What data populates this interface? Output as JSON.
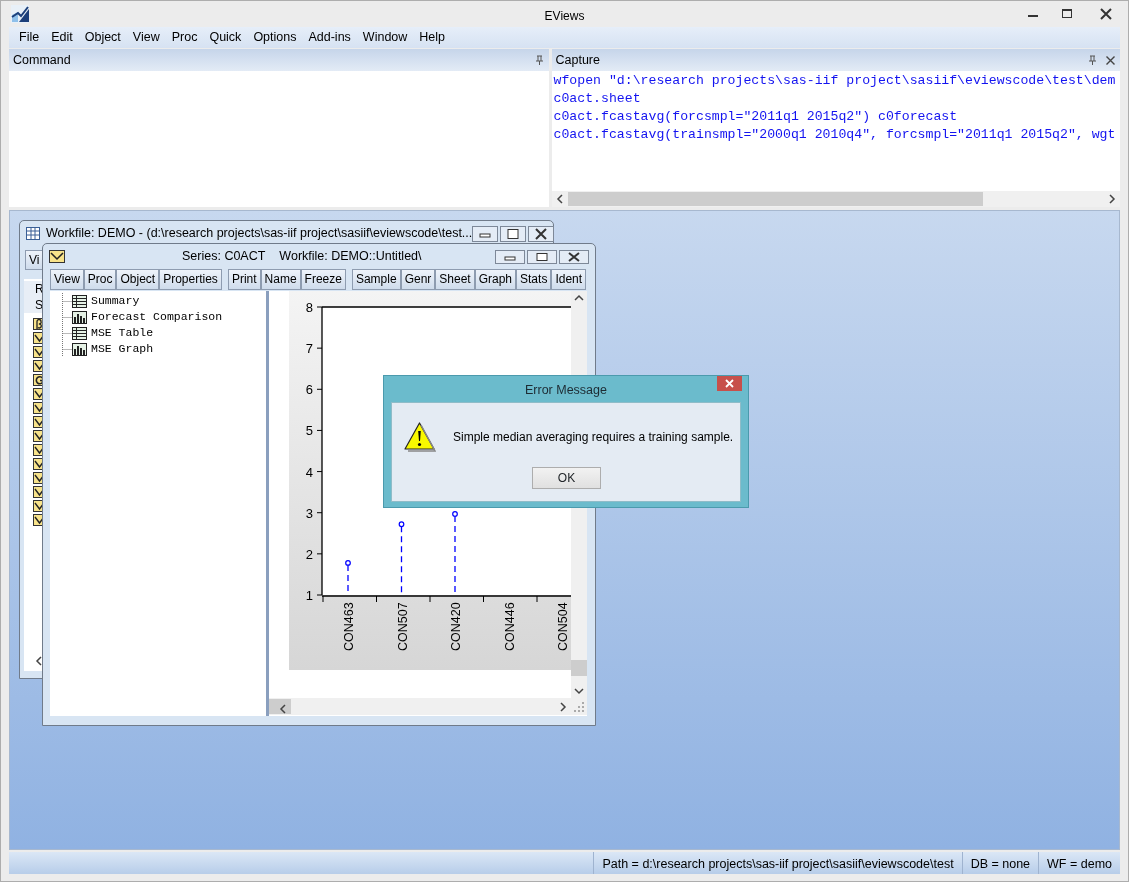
{
  "app": {
    "title": "EViews"
  },
  "menu": [
    {
      "label": "File"
    },
    {
      "label": "Edit"
    },
    {
      "label": "Object"
    },
    {
      "label": "View"
    },
    {
      "label": "Proc"
    },
    {
      "label": "Quick"
    },
    {
      "label": "Options"
    },
    {
      "label": "Add-ins"
    },
    {
      "label": "Window"
    },
    {
      "label": "Help"
    }
  ],
  "command_pane": {
    "title": "Command"
  },
  "capture_pane": {
    "title": "Capture",
    "lines": [
      "wfopen \"d:\\research projects\\sas-iif project\\sasiif\\eviewscode\\test\\dem",
      "c0act.sheet",
      "c0act.fcastavg(forcsmpl=\"2011q1 2015q2\") c0forecast",
      "c0act.fcastavg(trainsmpl=\"2000q1 2010q4\", forcsmpl=\"2011q1 2015q2\", wgt"
    ]
  },
  "workfile_window": {
    "title": "Workfile: DEMO - (d:\\research projects\\sas-iif project\\sasiif\\eviewscode\\test...",
    "toolbar": [
      "Vi"
    ],
    "labels": [
      "R",
      "S"
    ],
    "objects": [
      {
        "kind": "coef"
      },
      {
        "kind": "series"
      },
      {
        "kind": "series"
      },
      {
        "kind": "series"
      },
      {
        "kind": "group"
      },
      {
        "kind": "series"
      },
      {
        "kind": "series"
      },
      {
        "kind": "series"
      },
      {
        "kind": "series"
      },
      {
        "kind": "series"
      },
      {
        "kind": "series"
      },
      {
        "kind": "series"
      },
      {
        "kind": "series"
      },
      {
        "kind": "series"
      },
      {
        "kind": "series"
      }
    ]
  },
  "series_window": {
    "title": "Series: C0ACT",
    "workfile": "Workfile: DEMO::Untitled\\",
    "toolbar": [
      [
        "View",
        "Proc",
        "Object",
        "Properties"
      ],
      [
        "Print",
        "Name",
        "Freeze"
      ],
      [
        "Sample",
        "Genr",
        "Sheet",
        "Graph",
        "Stats",
        "Ident"
      ]
    ],
    "tree": [
      {
        "label": "Summary",
        "kind": "table"
      },
      {
        "label": "Forecast Comparison",
        "kind": "graph"
      },
      {
        "label": "MSE Table",
        "kind": "table"
      },
      {
        "label": "MSE Graph",
        "kind": "graph"
      }
    ],
    "chart_data": {
      "type": "scatter",
      "categories": [
        "CON463",
        "CON507",
        "CON420",
        "CON446",
        "CON504"
      ],
      "series": [
        {
          "color": "#0000ff",
          "values": [
            1.78,
            2.72,
            2.97,
            null,
            null
          ]
        }
      ],
      "ylim": [
        1,
        8
      ],
      "yticks": [
        1,
        2,
        3,
        4,
        5,
        6,
        7,
        8
      ]
    }
  },
  "dialog": {
    "title": "Error Message",
    "message": "Simple median averaging requires a training sample.",
    "button": "OK"
  },
  "status_bar": [
    "Path = d:\\research projects\\sas-iif project\\sasiif\\eviewscode\\test",
    "DB = none",
    "WF = demo"
  ]
}
